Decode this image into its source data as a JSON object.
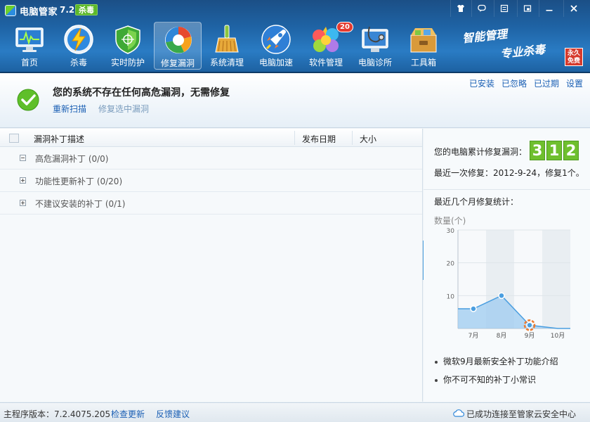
{
  "app": {
    "title": "电脑管家",
    "version": "7.2",
    "badge": "杀毒"
  },
  "toolbar": [
    {
      "label": "首页",
      "icon": "monitor-icon"
    },
    {
      "label": "杀毒",
      "icon": "lightning-icon"
    },
    {
      "label": "实时防护",
      "icon": "shield-icon"
    },
    {
      "label": "修复漏洞",
      "icon": "repair-icon"
    },
    {
      "label": "系统清理",
      "icon": "broom-icon"
    },
    {
      "label": "电脑加速",
      "icon": "rocket-icon"
    },
    {
      "label": "软件管理",
      "icon": "software-icon",
      "badge": "20"
    },
    {
      "label": "电脑诊所",
      "icon": "clinic-icon"
    },
    {
      "label": "工具箱",
      "icon": "toolbox-icon"
    }
  ],
  "slogan": {
    "line1": "智能管理",
    "line2": "专业杀毒",
    "stamp": "永久免费"
  },
  "status": {
    "message": "您的系统不存在任何高危漏洞，无需修复",
    "rescan": "重新扫描",
    "repair_selected": "修复选中漏洞"
  },
  "header_links": {
    "installed": "已安装",
    "ignored": "已忽略",
    "expired": "已过期",
    "settings": "设置"
  },
  "list": {
    "columns": {
      "description": "漏洞补丁描述",
      "date": "发布日期",
      "size": "大小"
    },
    "rows": [
      {
        "label": "高危漏洞补丁 (0/0)",
        "expanded": true
      },
      {
        "label": "功能性更新补丁 (0/20)",
        "expanded": false
      },
      {
        "label": "不建议安装的补丁 (0/1)",
        "expanded": false
      }
    ]
  },
  "panel": {
    "counter_label": "您的电脑累计修复漏洞：",
    "counter_digits": [
      "3",
      "1",
      "2"
    ],
    "last_fix": "最近一次修复：2012-9-24，修复1个。",
    "stats_title": "最近几个月修复统计：",
    "y_axis_label": "数量(个)",
    "links": [
      "微软9月最新安全补丁功能介绍",
      "你不可不知的补丁小常识"
    ]
  },
  "chart_data": {
    "type": "area",
    "categories": [
      "7月",
      "8月",
      "9月",
      "10月"
    ],
    "values": [
      6,
      10,
      1,
      0
    ],
    "yticks": [
      "10",
      "20",
      "30"
    ],
    "ylim": [
      0,
      30
    ],
    "highlight_index": 2,
    "fill_color": "#9dcbf0",
    "line_color": "#4a9ee0"
  },
  "footer": {
    "version": "主程序版本：7.2.4075.205",
    "check_update": "检查更新",
    "feedback": "反馈建议",
    "cloud_status": "已成功连接至管家云安全中心"
  }
}
